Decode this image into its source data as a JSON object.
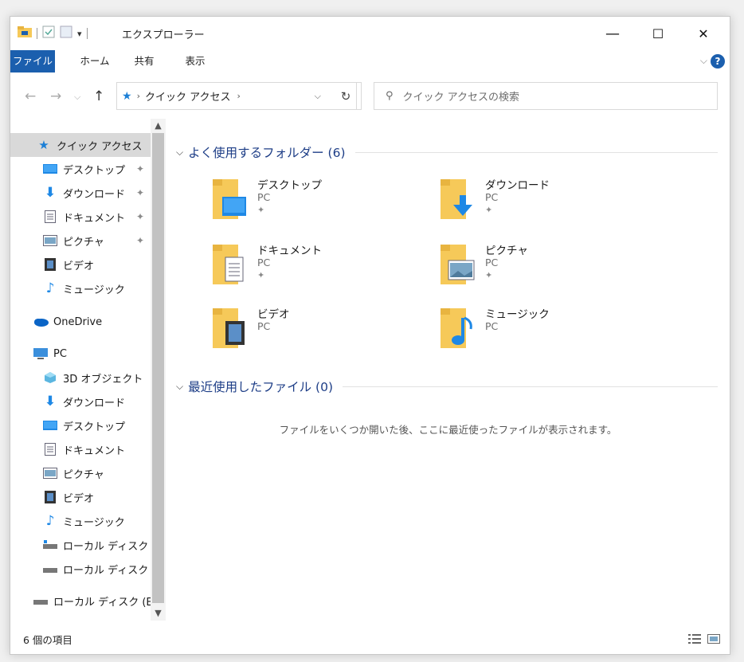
{
  "window": {
    "title": "エクスプローラー",
    "minimize": "—",
    "maximize": "☐",
    "close": "✕"
  },
  "ribbon": {
    "tabs": [
      "ファイル",
      "ホーム",
      "共有",
      "表示"
    ],
    "expand": "⌵",
    "help": "?"
  },
  "address": {
    "path": "クイック アクセス",
    "search_placeholder": "クイック アクセスの検索"
  },
  "sidebar": {
    "items": [
      {
        "label": "クイック アクセス",
        "icon": "star-icon"
      },
      {
        "label": "デスクトップ",
        "icon": "desktop-icon",
        "pinned": true
      },
      {
        "label": "ダウンロード",
        "icon": "download-icon",
        "pinned": true
      },
      {
        "label": "ドキュメント",
        "icon": "document-icon",
        "pinned": true
      },
      {
        "label": "ピクチャ",
        "icon": "pictures-icon",
        "pinned": true
      },
      {
        "label": "ビデオ",
        "icon": "video-icon"
      },
      {
        "label": "ミュージック",
        "icon": "music-icon"
      },
      {
        "label": "OneDrive",
        "icon": "cloud-icon"
      },
      {
        "label": "PC",
        "icon": "pc-icon"
      },
      {
        "label": "3D オブジェクト",
        "icon": "cube-icon"
      },
      {
        "label": "ダウンロード",
        "icon": "download-icon"
      },
      {
        "label": "デスクトップ",
        "icon": "desktop-icon"
      },
      {
        "label": "ドキュメント",
        "icon": "document-icon"
      },
      {
        "label": "ピクチャ",
        "icon": "pictures-icon"
      },
      {
        "label": "ビデオ",
        "icon": "video-icon"
      },
      {
        "label": "ミュージック",
        "icon": "music-icon"
      },
      {
        "label": "ローカル ディスク (C",
        "icon": "drive-icon"
      },
      {
        "label": "ローカル ディスク (E",
        "icon": "drive-icon"
      },
      {
        "label": "ローカル ディスク (E:)",
        "icon": "drive-icon"
      }
    ]
  },
  "main": {
    "frequent_header": "よく使用するフォルダー (6)",
    "recent_header": "最近使用したファイル (0)",
    "empty_message": "ファイルをいくつか開いた後、ここに最近使ったファイルが表示されます。",
    "folders": [
      {
        "name": "デスクトップ",
        "location": "PC",
        "pinned": true,
        "icon": "desktop-folder-icon"
      },
      {
        "name": "ダウンロード",
        "location": "PC",
        "pinned": true,
        "icon": "download-folder-icon"
      },
      {
        "name": "ドキュメント",
        "location": "PC",
        "pinned": true,
        "icon": "document-folder-icon"
      },
      {
        "name": "ピクチャ",
        "location": "PC",
        "pinned": true,
        "icon": "pictures-folder-icon"
      },
      {
        "name": "ビデオ",
        "location": "PC",
        "pinned": false,
        "icon": "video-folder-icon"
      },
      {
        "name": "ミュージック",
        "location": "PC",
        "pinned": false,
        "icon": "music-folder-icon"
      }
    ]
  },
  "status": {
    "item_count": "6 個の項目"
  },
  "colors": {
    "accent": "#1b5fae",
    "folder": "#f6c959",
    "header_text": "#1e3e87"
  }
}
